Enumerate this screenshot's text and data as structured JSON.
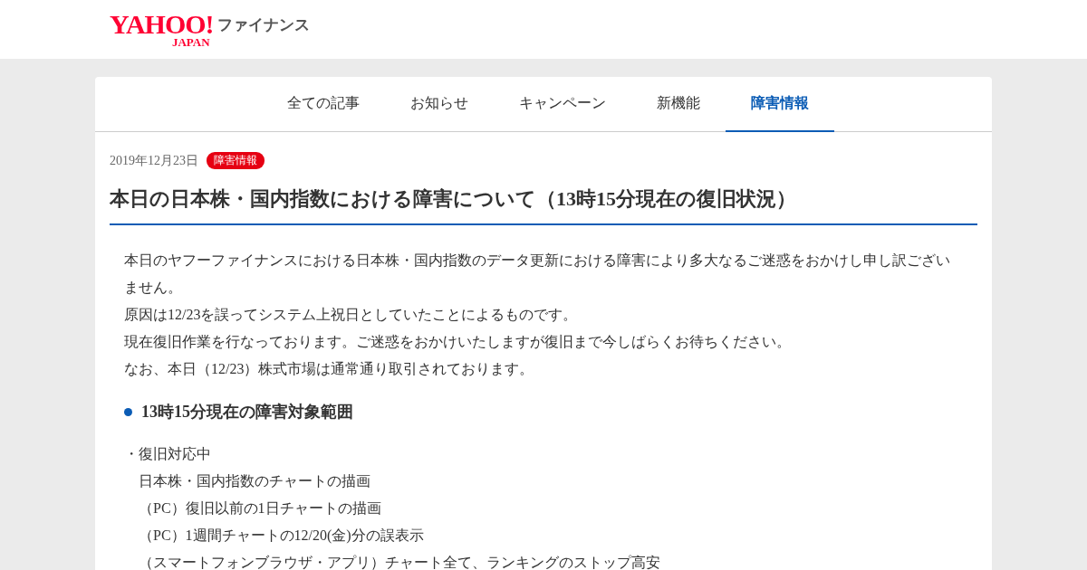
{
  "header": {
    "logo": {
      "brand": "YAHOO!",
      "region": "JAPAN",
      "service": "ファイナンス"
    }
  },
  "tabs": [
    {
      "label": "全ての記事",
      "selected": false
    },
    {
      "label": "お知らせ",
      "selected": false
    },
    {
      "label": "キャンペーン",
      "selected": false
    },
    {
      "label": "新機能",
      "selected": false
    },
    {
      "label": "障害情報",
      "selected": true
    }
  ],
  "article": {
    "date": "2019年12月23日",
    "category": "障害情報",
    "title": "本日の日本株・国内指数における障害について（13時15分現在の復旧状況）",
    "paragraphs": [
      "本日のヤフーファイナンスにおける日本株・国内指数のデータ更新における障害により多大なるご迷惑をおかけし申し訳ございません。",
      "原因は12/23を誤ってシステム上祝日としていたことによるものです。",
      "現在復旧作業を行なっております。ご迷惑をおかけいたしますが復旧まで今しばらくお待ちください。",
      "なお、本日（12/23）株式市場は通常通り取引されております。"
    ],
    "section_heading": "13時15分現在の障害対象範囲",
    "list_lines": [
      {
        "kind": "bullet",
        "text": "・復旧対応中"
      },
      {
        "kind": "indent",
        "text": "日本株・国内指数のチャートの描画"
      },
      {
        "kind": "indent",
        "text": "（PC）復旧以前の1日チャートの描画"
      },
      {
        "kind": "indent",
        "text": "（PC）1週間チャートの12/20(金)分の誤表示"
      },
      {
        "kind": "indent",
        "text": "（スマートフォンブラウザ・アプリ）チャート全て、ランキングのストップ高安"
      }
    ]
  }
}
